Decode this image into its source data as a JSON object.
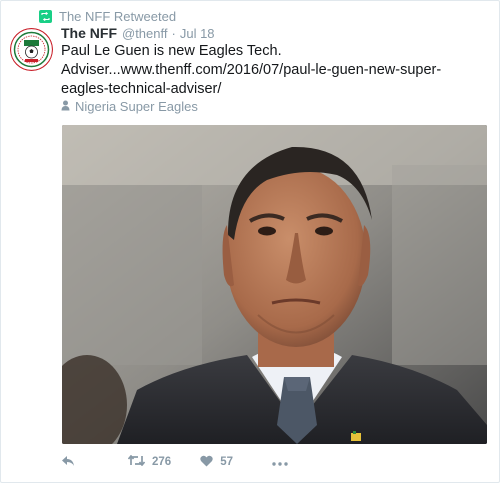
{
  "retweet_context": {
    "text": "The NFF Retweeted",
    "icon": "retweet-icon",
    "color": "#19cf86"
  },
  "author": {
    "name": "The NFF",
    "handle": "@thenff",
    "separator": "·",
    "time": "Jul 18",
    "avatar": "nff-logo"
  },
  "tweet": {
    "text": "Paul Le Guen is new Eagles Tech. Adviser...",
    "link": "www.thenff.com/2016/07/paul-le-guen-new-super-eagles-technical-adviser/"
  },
  "location": {
    "icon": "location-pin-icon",
    "text": "Nigeria Super Eagles"
  },
  "media": {
    "type": "photo",
    "subject": "portrait"
  },
  "actions": {
    "reply_icon": "reply-icon",
    "retweet_icon": "retweet-icon",
    "retweet_count": "276",
    "like_icon": "heart-icon",
    "like_count": "57",
    "more_icon": "more-icon"
  },
  "colors": {
    "text": "#14171a",
    "secondary": "#8899a6",
    "retweet_green": "#19cf86"
  }
}
